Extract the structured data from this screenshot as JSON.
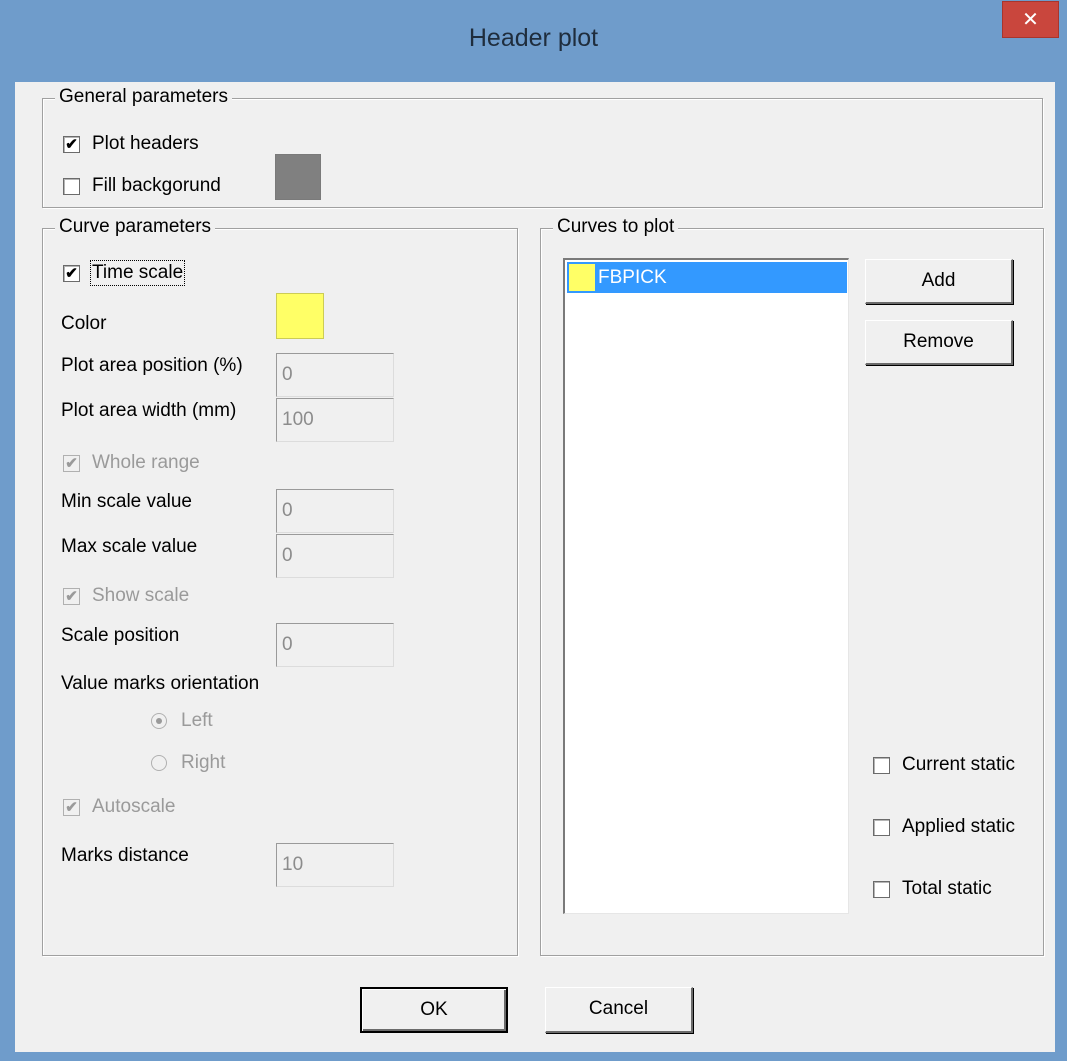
{
  "window": {
    "title": "Header plot",
    "close_label": "✕"
  },
  "general": {
    "legend": "General parameters",
    "plot_headers": {
      "label": "Plot headers",
      "checked": true
    },
    "fill_background": {
      "label": "Fill backgorund",
      "checked": false,
      "color": "#808080"
    }
  },
  "curve": {
    "legend": "Curve parameters",
    "time_scale": {
      "label": "Time scale",
      "checked": true
    },
    "color_label": "Color",
    "color": "#ffff66",
    "plot_area_position": {
      "label": "Plot area position (%)",
      "value": "0"
    },
    "plot_area_width": {
      "label": "Plot area width (mm)",
      "value": "100"
    },
    "whole_range": {
      "label": "Whole range",
      "checked": true,
      "enabled": false
    },
    "min_scale": {
      "label": "Min scale value",
      "value": "0"
    },
    "max_scale": {
      "label": "Max scale value",
      "value": "0"
    },
    "show_scale": {
      "label": "Show scale",
      "checked": true,
      "enabled": false
    },
    "scale_position": {
      "label": "Scale position",
      "value": "0"
    },
    "value_marks_label": "Value marks orientation",
    "orientation_left": {
      "label": "Left",
      "selected": true
    },
    "orientation_right": {
      "label": "Right",
      "selected": false
    },
    "autoscale": {
      "label": "Autoscale",
      "checked": true,
      "enabled": false
    },
    "marks_distance": {
      "label": "Marks distance",
      "value": "10"
    }
  },
  "curves": {
    "legend": "Curves to plot",
    "items": [
      {
        "name": "FBPICK",
        "color": "#ffff66",
        "selected": true
      }
    ],
    "add_label": "Add",
    "remove_label": "Remove",
    "current_static": {
      "label": "Current static",
      "checked": false
    },
    "applied_static": {
      "label": "Applied static",
      "checked": false
    },
    "total_static": {
      "label": "Total static",
      "checked": false
    }
  },
  "buttons": {
    "ok_label": "OK",
    "cancel_label": "Cancel"
  }
}
